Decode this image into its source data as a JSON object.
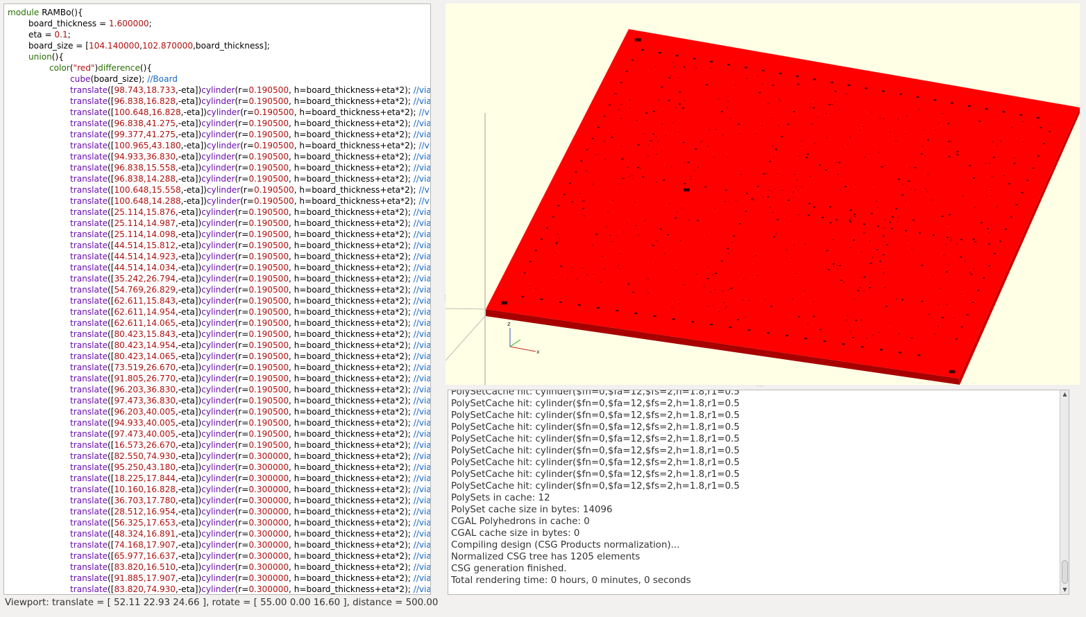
{
  "editor": {
    "lines": [
      {
        "indent": 0,
        "parts": [
          {
            "c": "kw",
            "t": "module "
          },
          {
            "c": "",
            "t": "RAMBo(){"
          }
        ]
      },
      {
        "indent": 1,
        "parts": [
          {
            "c": "",
            "t": "board_thickness = "
          },
          {
            "c": "num",
            "t": "1.600000"
          },
          {
            "c": "",
            "t": ";"
          }
        ]
      },
      {
        "indent": 1,
        "parts": [
          {
            "c": "",
            "t": "eta = "
          },
          {
            "c": "num",
            "t": "0.1"
          },
          {
            "c": "",
            "t": ";"
          }
        ]
      },
      {
        "indent": 1,
        "parts": [
          {
            "c": "",
            "t": "board_size = ["
          },
          {
            "c": "num",
            "t": "104.140000"
          },
          {
            "c": "",
            "t": ","
          },
          {
            "c": "num",
            "t": "102.870000"
          },
          {
            "c": "",
            "t": ",board_thickness];"
          }
        ]
      },
      {
        "indent": 1,
        "parts": [
          {
            "c": "kw",
            "t": "union"
          },
          {
            "c": "",
            "t": "(){"
          }
        ]
      },
      {
        "indent": 2,
        "parts": [
          {
            "c": "kw",
            "t": "color"
          },
          {
            "c": "",
            "t": "("
          },
          {
            "c": "str",
            "t": "\"red\""
          },
          {
            "c": "",
            "t": ")"
          },
          {
            "c": "kw",
            "t": "difference"
          },
          {
            "c": "",
            "t": "(){"
          }
        ]
      },
      {
        "indent": 3,
        "parts": [
          {
            "c": "fn",
            "t": "cube"
          },
          {
            "c": "",
            "t": "(board_size); "
          },
          {
            "c": "cm",
            "t": "//Board"
          }
        ]
      }
    ],
    "vias": [
      [
        "98.743,18.733",
        "0.190500"
      ],
      [
        "96.838,16.828",
        "0.190500"
      ],
      [
        "100.648,16.828",
        "0.190500"
      ],
      [
        "96.838,41.275",
        "0.190500"
      ],
      [
        "99.377,41.275",
        "0.190500"
      ],
      [
        "100.965,43.180",
        "0.190500"
      ],
      [
        "94.933,36.830",
        "0.190500"
      ],
      [
        "96.838,15.558",
        "0.190500"
      ],
      [
        "96.838,14.288",
        "0.190500"
      ],
      [
        "100.648,15.558",
        "0.190500"
      ],
      [
        "100.648,14.288",
        "0.190500"
      ],
      [
        "25.114,15.876",
        "0.190500"
      ],
      [
        "25.114,14.987",
        "0.190500"
      ],
      [
        "25.114,14.098",
        "0.190500"
      ],
      [
        "44.514,15.812",
        "0.190500"
      ],
      [
        "44.514,14.923",
        "0.190500"
      ],
      [
        "44.514,14.034",
        "0.190500"
      ],
      [
        "35.242,26.794",
        "0.190500"
      ],
      [
        "54.769,26.829",
        "0.190500"
      ],
      [
        "62.611,15.843",
        "0.190500"
      ],
      [
        "62.611,14.954",
        "0.190500"
      ],
      [
        "62.611,14.065",
        "0.190500"
      ],
      [
        "80.423,15.843",
        "0.190500"
      ],
      [
        "80.423,14.954",
        "0.190500"
      ],
      [
        "80.423,14.065",
        "0.190500"
      ],
      [
        "73.519,26.670",
        "0.190500"
      ],
      [
        "91.805,26.770",
        "0.190500"
      ],
      [
        "96.203,36.830",
        "0.190500"
      ],
      [
        "97.473,36.830",
        "0.190500"
      ],
      [
        "96.203,40.005",
        "0.190500"
      ],
      [
        "94.933,40.005",
        "0.190500"
      ],
      [
        "97.473,40.005",
        "0.190500"
      ],
      [
        "16.573,26.670",
        "0.190500"
      ],
      [
        "82.550,74.930",
        "0.300000"
      ],
      [
        "95.250,43.180",
        "0.300000"
      ],
      [
        "18.225,17.844",
        "0.300000"
      ],
      [
        "10.160,16.828",
        "0.300000"
      ],
      [
        "36.703,17.780",
        "0.300000"
      ],
      [
        "28.512,16.954",
        "0.300000"
      ],
      [
        "56.325,17.653",
        "0.300000"
      ],
      [
        "48.324,16.891",
        "0.300000"
      ],
      [
        "74.168,17.907",
        "0.300000"
      ],
      [
        "65.977,16.637",
        "0.300000"
      ],
      [
        "83.820,16.510",
        "0.300000"
      ],
      [
        "91.885,17.907",
        "0.300000"
      ],
      [
        "83.820,74.930",
        "0.300000"
      ]
    ],
    "via_tokens": {
      "fn": "translate",
      "open": "([",
      "eta": ",-eta])",
      "cyl": "cylinder",
      "r": "(r=",
      "h": ", h=board_thickness+eta*2); ",
      "cm": "//via"
    }
  },
  "console": {
    "lines": [
      "PolySetCache hit: cylinder($fn=0,$fa=12,$fs=2,h=1.8,r1=0.5",
      "PolySetCache hit: cylinder($fn=0,$fa=12,$fs=2,h=1.8,r1=0.5",
      "PolySetCache hit: cylinder($fn=0,$fa=12,$fs=2,h=1.8,r1=0.5",
      "PolySetCache hit: cylinder($fn=0,$fa=12,$fs=2,h=1.8,r1=0.5",
      "PolySetCache hit: cylinder($fn=0,$fa=12,$fs=2,h=1.8,r1=0.5",
      "PolySetCache hit: cylinder($fn=0,$fa=12,$fs=2,h=1.8,r1=0.5",
      "PolySetCache hit: cylinder($fn=0,$fa=12,$fs=2,h=1.8,r1=0.5",
      "PolySetCache hit: cylinder($fn=0,$fa=12,$fs=2,h=1.8,r1=0.5",
      "PolySetCache hit: cylinder($fn=0,$fa=12,$fs=2,h=1.8,r1=0.5",
      "PolySets in cache: 12",
      "PolySet cache size in bytes: 14096",
      "CGAL Polyhedrons in cache: 0",
      "CGAL cache size in bytes: 0",
      "Compiling design (CSG Products normalization)...",
      "Normalized CSG tree has 1205 elements",
      "CSG generation finished.",
      "Total rendering time: 0 hours, 0 minutes, 0 seconds"
    ]
  },
  "status": {
    "text": "Viewport: translate = [ 52.11 22.93 24.66 ], rotate = [ 55.00 0.00 16.60 ], distance = 500.00"
  },
  "viewport": {
    "board_color": "#ff0000",
    "side_color": "#a80000",
    "background": "#ffffe5",
    "axis_labels": [
      "z",
      "x"
    ]
  },
  "icons": {
    "up": "▲",
    "down": "▼",
    "dots": "⋮"
  }
}
